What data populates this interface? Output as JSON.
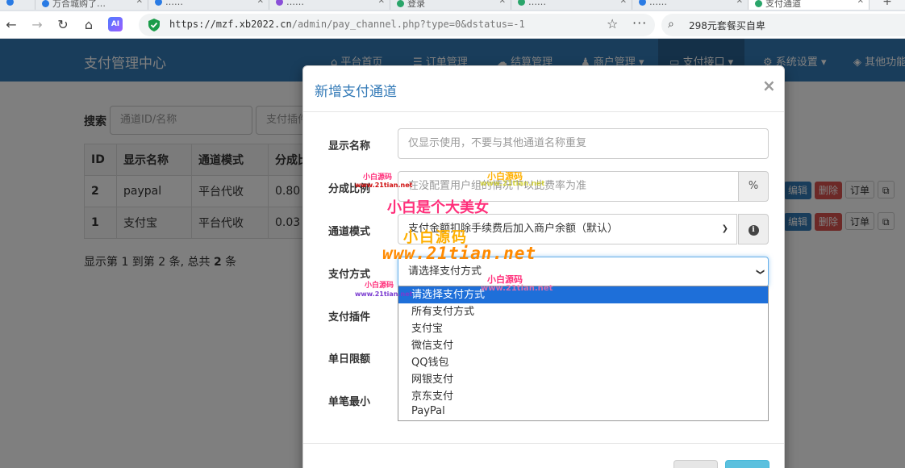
{
  "browser": {
    "tabs": [
      {
        "label": "万合城购了…"
      },
      {
        "label": "……"
      },
      {
        "label": "……"
      },
      {
        "label": "登录"
      },
      {
        "label": "……"
      },
      {
        "label": "……"
      },
      {
        "label": "支付通道"
      }
    ],
    "url_host": "https://mzf.xb2022.cn",
    "url_path": "/admin/pay_channel.php?type=0&dstatus=-1",
    "search_query": "298元套餐买自卑",
    "ai_label": "AI"
  },
  "app": {
    "brand": "支付管理中心",
    "nav": [
      {
        "label": "平台首页",
        "icon": "home-icon"
      },
      {
        "label": "订单管理",
        "icon": "list-icon"
      },
      {
        "label": "结算管理",
        "icon": "cloud-icon"
      },
      {
        "label": "商户管理",
        "icon": "user-icon"
      },
      {
        "label": "支付接口",
        "icon": "card-icon"
      },
      {
        "label": "系统设置",
        "icon": "gear-icon"
      },
      {
        "label": "其他功能",
        "icon": "cube-icon"
      }
    ],
    "search_label": "搜索",
    "search_placeholder": "通道ID/名称",
    "plugin_placeholder": "支付插件",
    "table": {
      "headers": [
        "ID",
        "显示名称",
        "通道模式",
        "分成比"
      ],
      "rows": [
        {
          "id": "2",
          "name": "paypal",
          "mode": "平台代收",
          "rate": "0.80"
        },
        {
          "id": "1",
          "name": "支付宝",
          "mode": "平台代收",
          "rate": "0.03"
        }
      ],
      "actions": {
        "edit": "编辑",
        "delete": "删除",
        "order": "订单"
      }
    },
    "pager_prefix": "显示第 1 到第 2 条, 总共 ",
    "pager_count": "2",
    "pager_suffix": " 条"
  },
  "modal": {
    "title": "新增支付通道",
    "close": "×",
    "fields": {
      "name_label": "显示名称",
      "name_placeholder": "仅显示使用，不要与其他通道名称重复",
      "rate_label": "分成比例",
      "rate_placeholder": "在没配置用户组的情况下以此费率为准",
      "rate_unit": "%",
      "mode_label": "通道模式",
      "mode_value": "支付金额扣除手续费后加入商户余额（默认）",
      "paytype_label": "支付方式",
      "paytype_value": "请选择支付方式",
      "plugin_label": "支付插件",
      "daylimit_label": "单日限额",
      "minlimit_label": "单笔最小"
    },
    "dropdown_options": [
      "请选择支付方式",
      "所有支付方式",
      "支付宝",
      "微信支付",
      "QQ钱包",
      "网银支付",
      "京东支付",
      "PayPal"
    ]
  },
  "watermarks": {
    "cn_big": "小白是个大美女",
    "yuan_big": "小白源码",
    "url_big": "www.21tian.net",
    "yuan_small": "小白源码",
    "url_small": "www.21tian.net"
  }
}
